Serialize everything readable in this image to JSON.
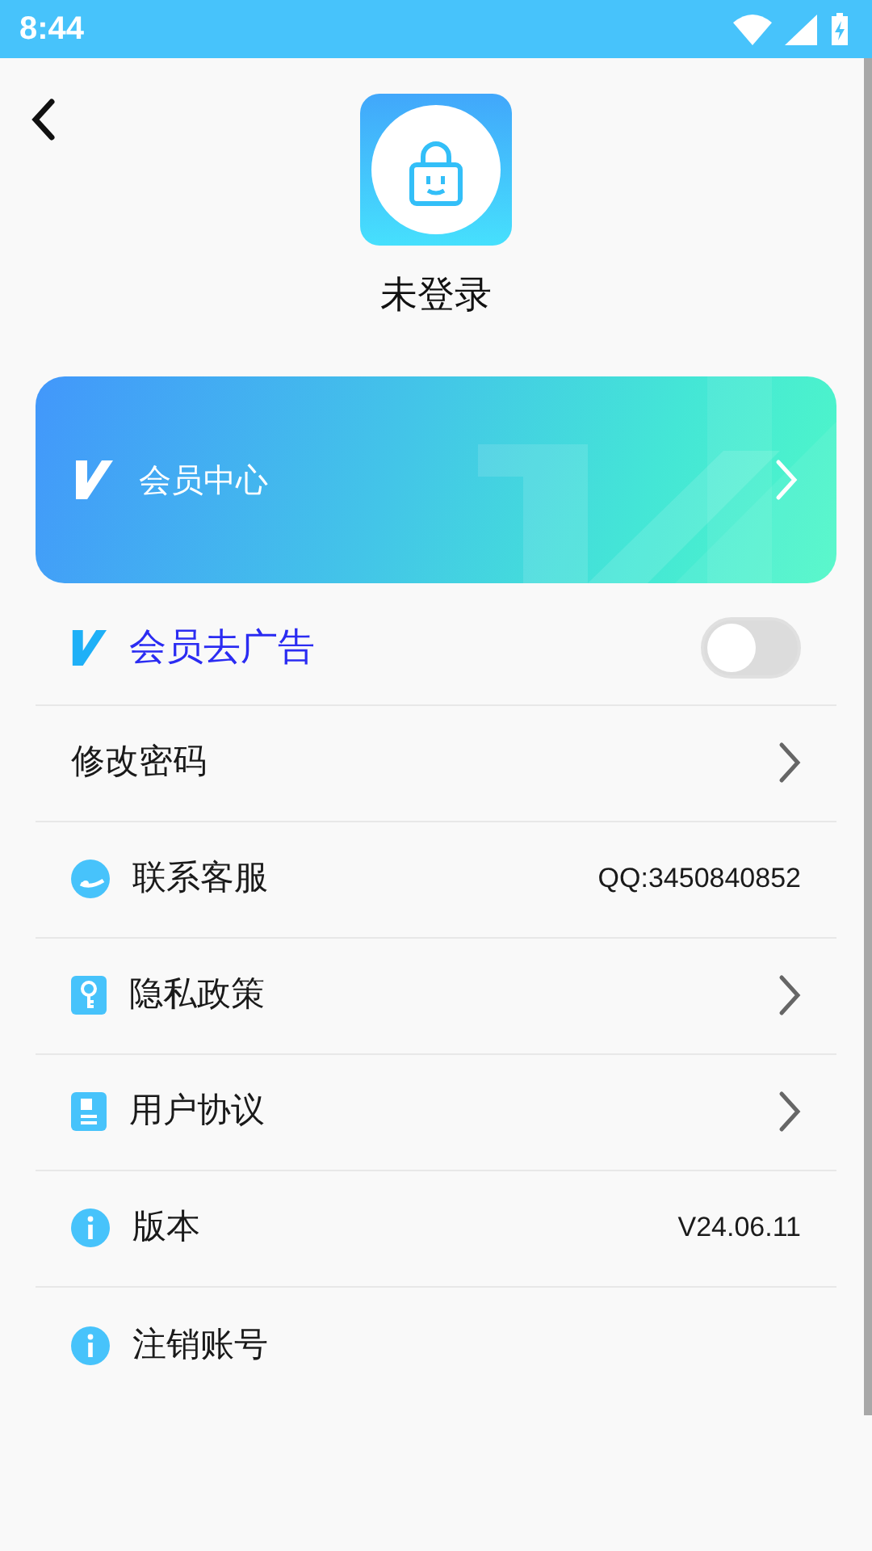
{
  "status_bar": {
    "time": "8:44"
  },
  "profile": {
    "name": "未登录"
  },
  "vip_card": {
    "label": "会员中心"
  },
  "rows": [
    {
      "kind": "toggle",
      "label": "会员去广告",
      "on": false
    },
    {
      "kind": "link",
      "label": "修改密码"
    },
    {
      "kind": "value",
      "label": "联系客服",
      "value": "QQ:3450840852"
    },
    {
      "kind": "link",
      "label": "隐私政策"
    },
    {
      "kind": "link",
      "label": "用户协议"
    },
    {
      "kind": "value",
      "label": "版本",
      "value": "V24.06.11"
    },
    {
      "kind": "plain",
      "label": "注销账号"
    }
  ]
}
